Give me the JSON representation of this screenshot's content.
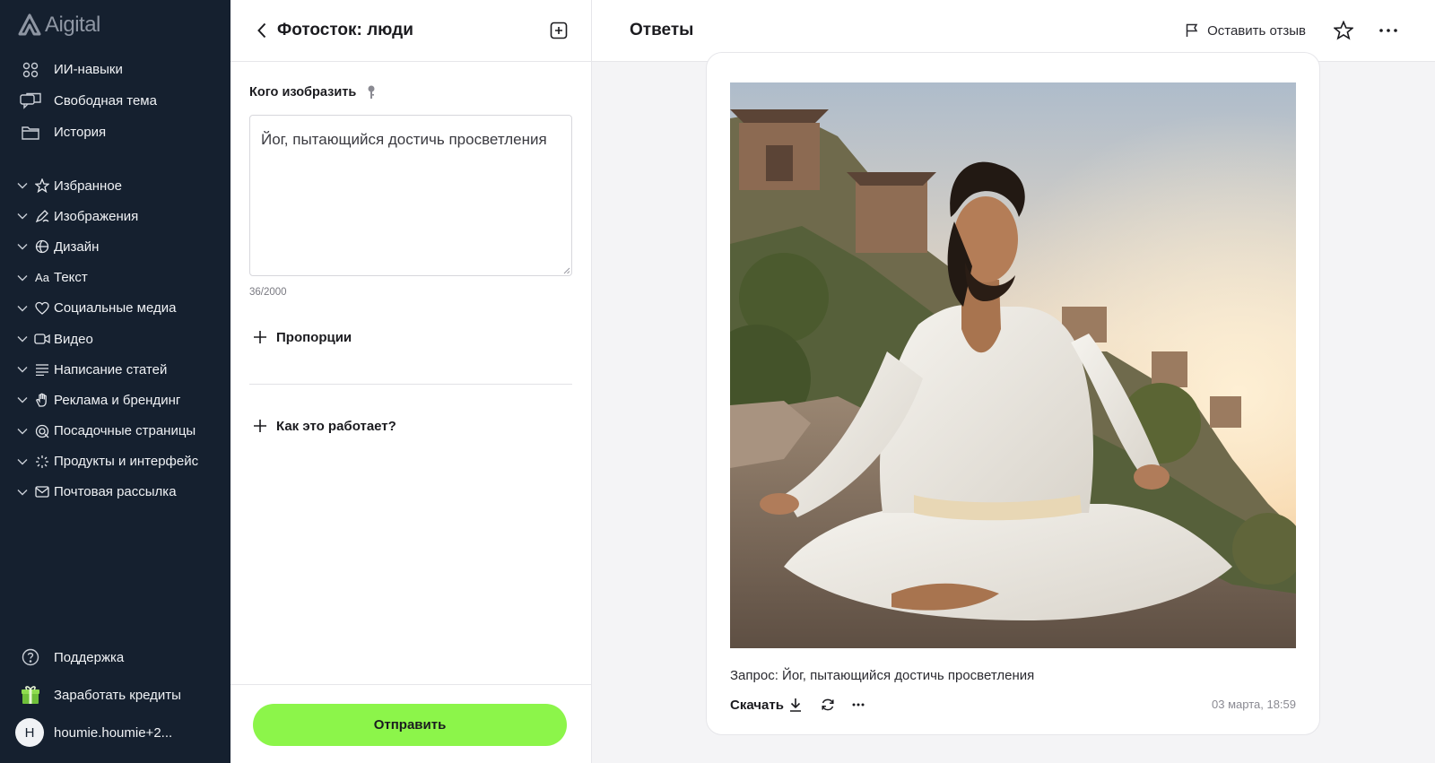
{
  "app": {
    "logo_text": "Aigital"
  },
  "sidebar": {
    "top_items": [
      {
        "label": "ИИ-навыки",
        "icon": "grid-icon"
      },
      {
        "label": "Свободная тема",
        "icon": "chat-icon"
      },
      {
        "label": "История",
        "icon": "folder-icon"
      }
    ],
    "categories": [
      {
        "label": "Избранное",
        "icon": "star-icon"
      },
      {
        "label": "Изображения",
        "icon": "pen-icon"
      },
      {
        "label": "Дизайн",
        "icon": "globe-icon"
      },
      {
        "label": "Текст",
        "icon": "text-icon",
        "icon_text": "Aa"
      },
      {
        "label": "Социальные медиа",
        "icon": "heart-icon"
      },
      {
        "label": "Видео",
        "icon": "video-icon"
      },
      {
        "label": "Написание статей",
        "icon": "lines-icon"
      },
      {
        "label": "Реклама и брендинг",
        "icon": "hand-icon"
      },
      {
        "label": "Посадочные страницы",
        "icon": "landing-icon"
      },
      {
        "label": "Продукты и интерфейс",
        "icon": "sparkle-icon"
      },
      {
        "label": "Почтовая рассылка",
        "icon": "mail-icon"
      }
    ],
    "support_label": "Поддержка",
    "credits_label": "Заработать кредиты",
    "user": {
      "initial": "H",
      "name": "houmie.houmie+2..."
    }
  },
  "panel": {
    "title": "Фотосток: люди",
    "field_label": "Кого изобразить",
    "prompt_value": "Йог, пытающийся достичь просветления",
    "counter": "36/2000",
    "proportions_label": "Пропорции",
    "how_label": "Как это работает?",
    "submit_label": "Отправить"
  },
  "main": {
    "title": "Ответы",
    "feedback_label": "Оставить отзыв",
    "answer": {
      "prompt_line": "Запрос: Йог, пытающийся достичь просветления",
      "download_label": "Скачать",
      "timestamp": "03 марта, 18:59"
    }
  },
  "colors": {
    "sidebar_bg": "#15202f",
    "accent": "#8cf54a"
  }
}
